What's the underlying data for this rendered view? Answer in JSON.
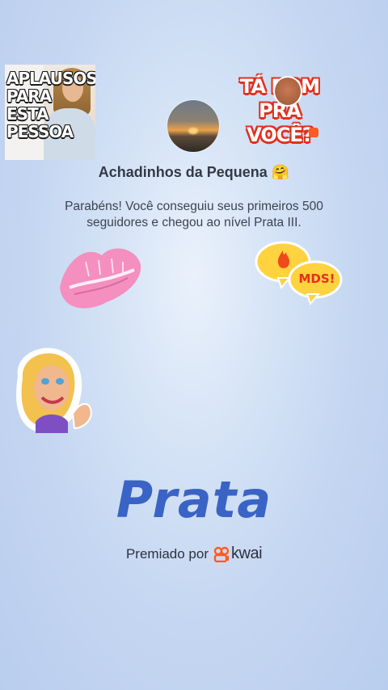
{
  "stickers": {
    "aplausos_lines": [
      "APLAUSOS",
      "PARA ESTA",
      "PESSOA"
    ],
    "tabom_lines": [
      "TÁ BOM",
      "PRA VOCÊ?"
    ],
    "mds_text": "MDS!"
  },
  "profile": {
    "name": "Achadinhos da Pequena 🤗"
  },
  "message": "Parabéns! Você conseguiu seus primeiros 500 seguidores e chegou ao nível Prata III.",
  "level": "Prata",
  "footer": {
    "awarded_by": "Premiado por",
    "brand": "kwai"
  },
  "colors": {
    "level_blue": "#3a63c6",
    "kwai_orange": "#ff5a1f",
    "kiss_pink": "#f48fbf",
    "mds_yellow": "#ffd23f"
  }
}
